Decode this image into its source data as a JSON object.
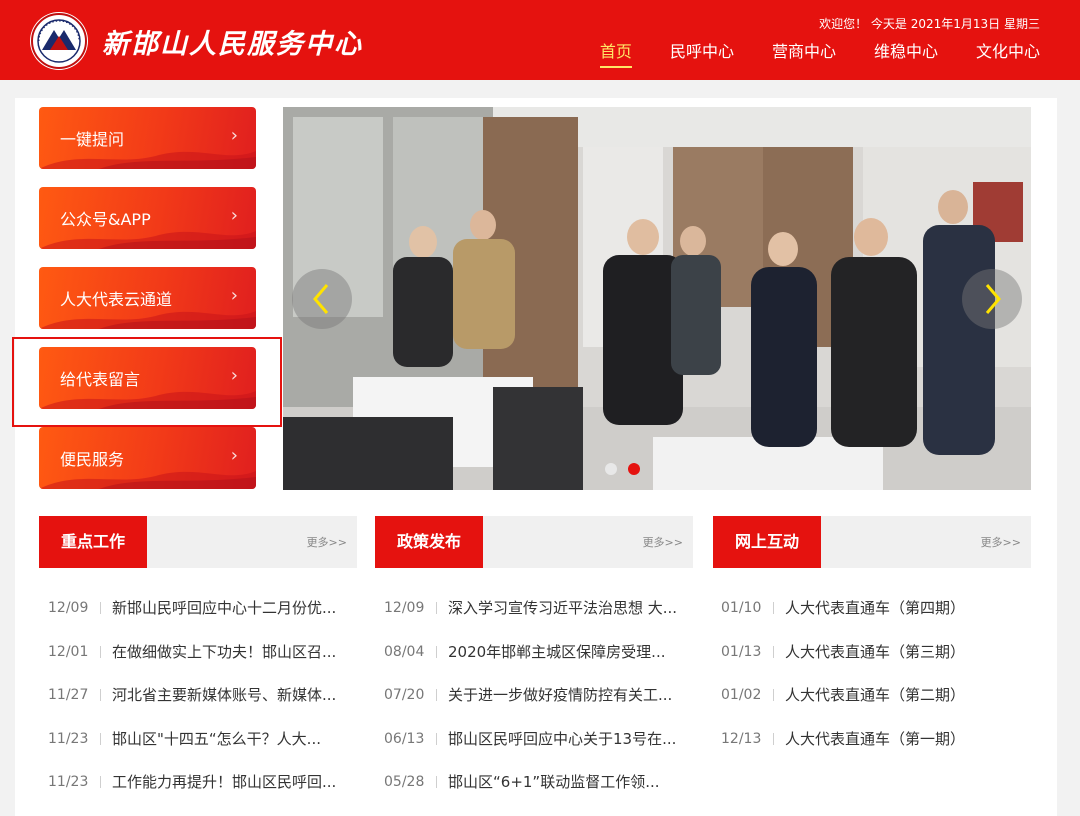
{
  "header": {
    "site_name": "新邯山人民服务中心",
    "date_line": "欢迎您！ 今天是 2021年1月13日 星期三",
    "nav": [
      "首页",
      "民呼中心",
      "营商中心",
      "维稳中心",
      "文化中心"
    ],
    "brand_color": "#e5120f",
    "active_color": "#ffe566"
  },
  "sidebar": {
    "items": [
      {
        "label": "一键提问"
      },
      {
        "label": "公众号&APP"
      },
      {
        "label": "人大代表云通道"
      },
      {
        "label": "给代表留言"
      },
      {
        "label": "便民服务"
      }
    ],
    "chevron": "›",
    "highlighted_index": 3
  },
  "banner": {
    "prev_icon": "chevron-left-icon",
    "next_icon": "chevron-right-icon",
    "slides_count": 2,
    "active_slide": 2
  },
  "sections": [
    {
      "title": "重点工作",
      "more": "更多>>",
      "items": [
        {
          "date": "12/09",
          "text": "新邯山民呼回应中心十二月份优..."
        },
        {
          "date": "12/01",
          "text": "在做细做实上下功夫！邯山区召..."
        },
        {
          "date": "11/27",
          "text": "河北省主要新媒体账号、新媒体..."
        },
        {
          "date": "11/23",
          "text": "邯山区\"十四五“怎么干？人大..."
        },
        {
          "date": "11/23",
          "text": "工作能力再提升！邯山区民呼回..."
        }
      ]
    },
    {
      "title": "政策发布",
      "more": "更多>>",
      "items": [
        {
          "date": "12/09",
          "text": "深入学习宣传习近平法治思想 大..."
        },
        {
          "date": "08/04",
          "text": "2020年邯郸主城区保障房受理..."
        },
        {
          "date": "07/20",
          "text": "关于进一步做好疫情防控有关工..."
        },
        {
          "date": "06/13",
          "text": "邯山区民呼回应中心关于13号在..."
        },
        {
          "date": "05/28",
          "text": "邯山区“6+1”联动监督工作领..."
        }
      ]
    },
    {
      "title": "网上互动",
      "more": "更多>>",
      "items": [
        {
          "date": "01/10",
          "text": "人大代表直通车（第四期）"
        },
        {
          "date": "01/13",
          "text": "人大代表直通车（第三期）"
        },
        {
          "date": "01/02",
          "text": "人大代表直通车（第二期）"
        },
        {
          "date": "12/13",
          "text": "人大代表直通车（第一期）"
        }
      ]
    }
  ]
}
